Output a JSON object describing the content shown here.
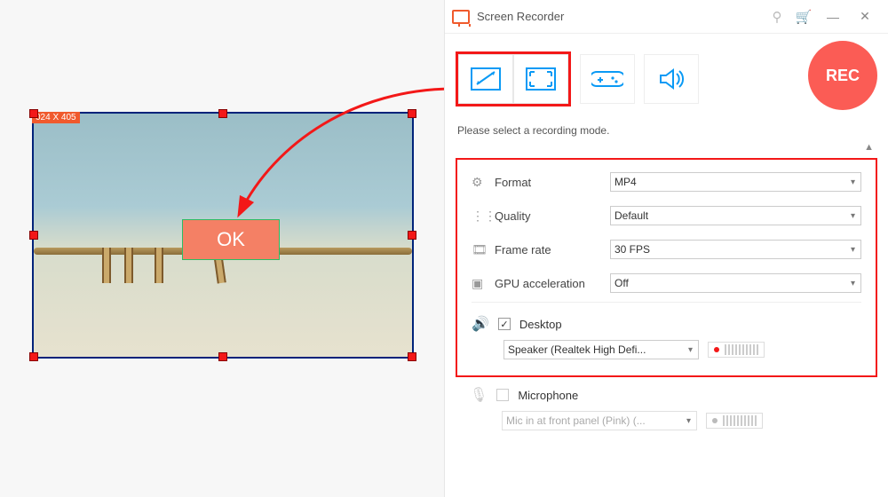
{
  "selection": {
    "dimensions_label": "024 X 405",
    "ok_label": "OK"
  },
  "app": {
    "title": "Screen Recorder",
    "rec_label": "REC",
    "hint": "Please select a recording mode."
  },
  "settings": {
    "format": {
      "label": "Format",
      "value": "MP4"
    },
    "quality": {
      "label": "Quality",
      "value": "Default"
    },
    "fps": {
      "label": "Frame rate",
      "value": "30 FPS"
    },
    "gpu": {
      "label": "GPU acceleration",
      "value": "Off"
    }
  },
  "audio": {
    "desktop": {
      "label": "Desktop",
      "checked": true,
      "device": "Speaker (Realtek High Defi..."
    },
    "mic": {
      "label": "Microphone",
      "checked": false,
      "device": "Mic in at front panel (Pink) (..."
    }
  }
}
